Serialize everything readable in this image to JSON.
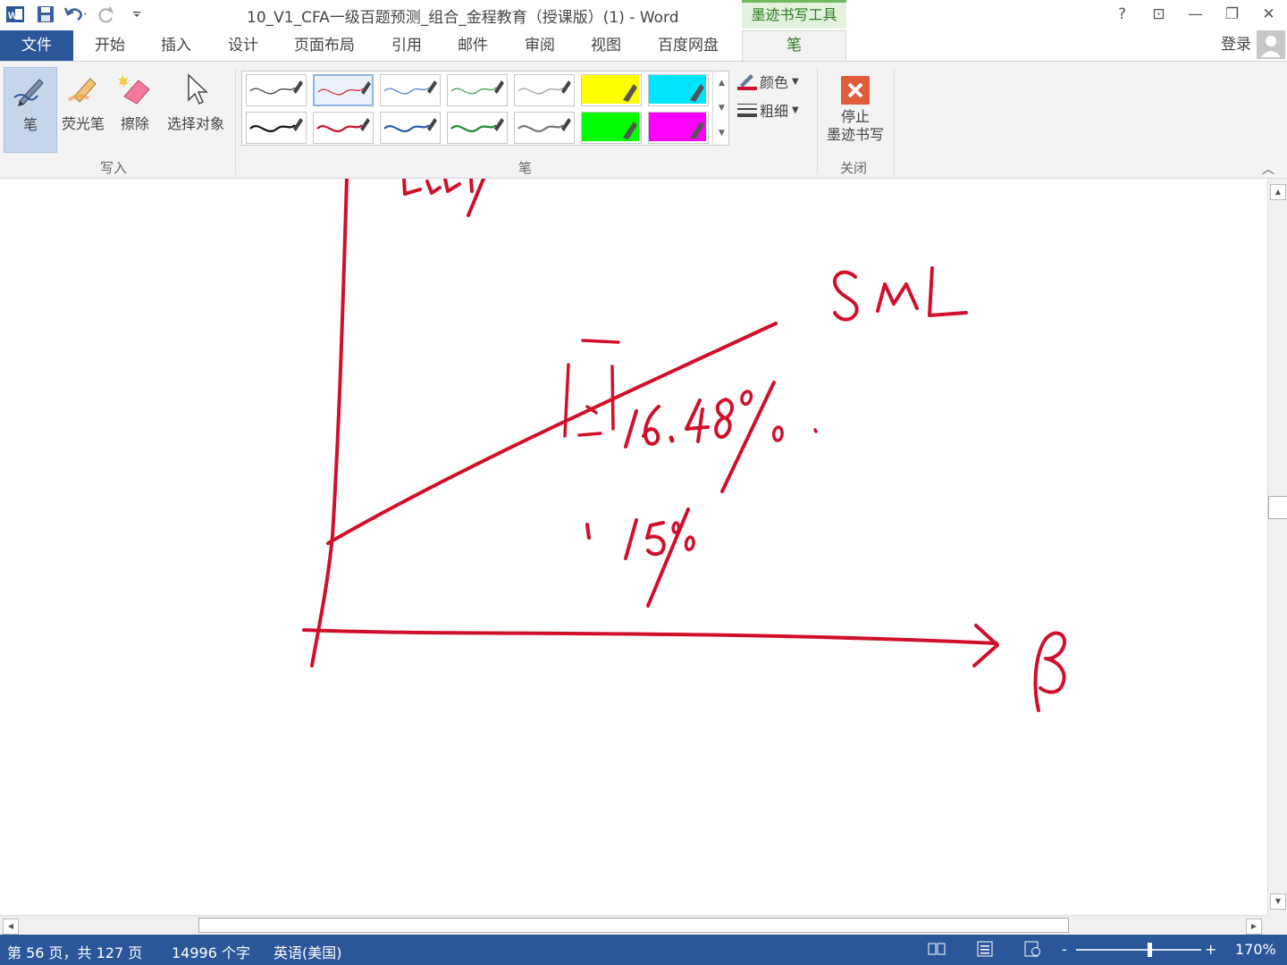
{
  "titlebar": {
    "document_title": "10_V1_CFA一级百题预测_组合_金程教育（授课版）(1) - Word",
    "context_group": "墨迹书写工具",
    "help": "?",
    "ribbon_display": "⊡",
    "minimize": "—",
    "restore": "❐",
    "close": "✕"
  },
  "tabs": {
    "file": "文件",
    "items": [
      "开始",
      "插入",
      "设计",
      "页面布局",
      "引用",
      "邮件",
      "审阅",
      "视图",
      "百度网盘"
    ],
    "active": "笔",
    "signin": "登录"
  },
  "ribbon": {
    "write_group": {
      "label": "写入",
      "pen": "笔",
      "highlighter": "荧光笔",
      "eraser": "擦除",
      "select": "选择对象"
    },
    "pens_group": {
      "label": "笔",
      "color": "颜色",
      "thickness": "粗细",
      "pen_colors_row1": [
        "#333333",
        "#d9262b",
        "#4a7cc4",
        "#3a9a4a",
        "#9a9a9a",
        "#ffff00",
        "#00e5ff"
      ],
      "pen_colors_row2": [
        "#111111",
        "#c8102e",
        "#2f5ea8",
        "#1f8a34",
        "#777777",
        "#00ff00",
        "#ff00ff"
      ]
    },
    "close_group": {
      "label": "关闭",
      "stop_line1": "停止",
      "stop_line2": "墨迹书写"
    }
  },
  "document": {
    "ink_color": "#d0102a",
    "handwriting": {
      "sml_label": "SML",
      "rate_high": "16.48%",
      "rate_low": "15%",
      "x_axis_label": "β"
    }
  },
  "statusbar": {
    "page": "第 56 页，共 127 页",
    "words": "14996 个字",
    "language": "英语(美国)",
    "zoom_minus": "-",
    "zoom_plus": "+",
    "zoom_percent": 170,
    "zoom_level": "170%"
  }
}
